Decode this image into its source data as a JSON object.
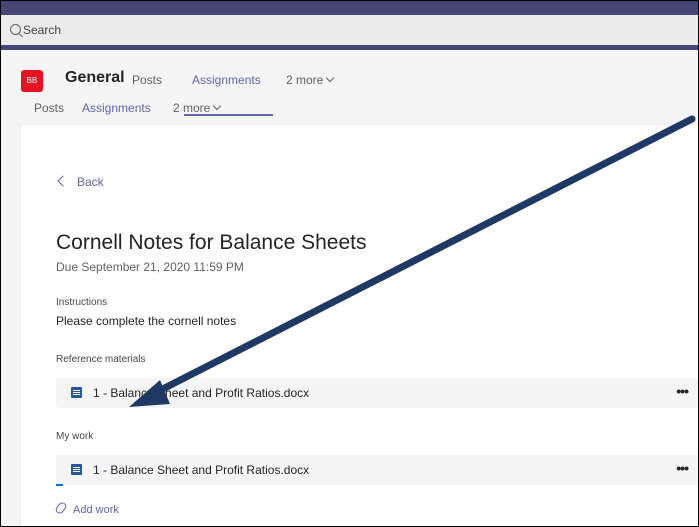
{
  "search": {
    "placeholder": "Search"
  },
  "channel": {
    "avatar": "BB",
    "name": "General",
    "tabs": [
      {
        "label": "Posts"
      },
      {
        "label": "Assignments"
      },
      {
        "label": "2 more"
      }
    ],
    "tabs_row2": [
      {
        "label": "Posts"
      },
      {
        "label": "Assignments"
      },
      {
        "label": "2 more"
      }
    ]
  },
  "assignment": {
    "back_label": "Back",
    "title": "Cornell Notes for Balance Sheets",
    "due": "Due September 21, 2020 11:59 PM",
    "instructions_label": "Instructions",
    "instructions_text": "Please complete the cornell notes",
    "reference_label": "Reference materials",
    "reference_file": "1 - Balance Sheet and Profit Ratios.docx",
    "mywork_label": "My work",
    "mywork_file": "1 - Balance Sheet and Profit Ratios.docx",
    "more_glyph": "•••",
    "add_work_label": "Add work"
  },
  "colors": {
    "brand": "#6264a7",
    "header": "#464775",
    "avatar": "#e81123",
    "arrow": "#1f3864"
  }
}
